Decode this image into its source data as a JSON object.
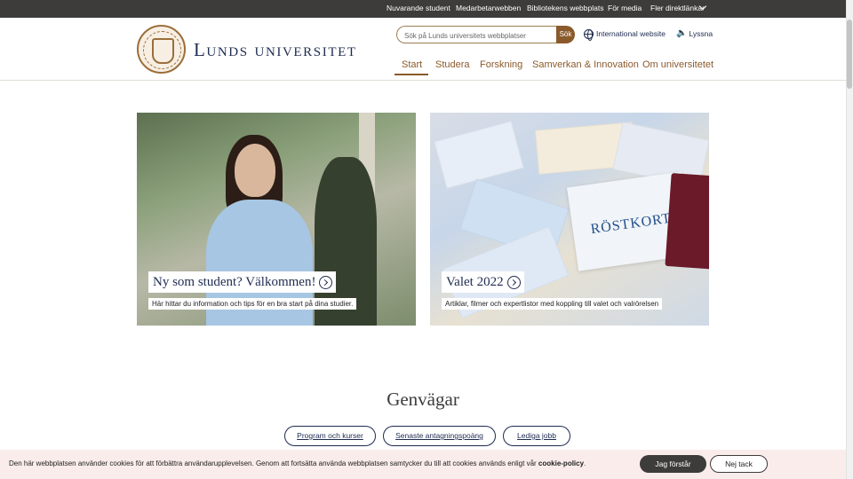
{
  "topbar": {
    "links": [
      "Nuvarande student",
      "Medarbetarwebben",
      "Bibliotekens webbplats",
      "För media",
      "Fler direktlänkar"
    ]
  },
  "header": {
    "logo_text": "Lunds universitet",
    "search_placeholder": "Sök på Lunds universitets webbplatser",
    "search_button": "Sök",
    "international_link": "International website",
    "listen_link": "Lyssna",
    "icons": [
      "globe-icon",
      "speaker-icon",
      "chevron-down-icon",
      "university-seal"
    ]
  },
  "nav": {
    "items": [
      "Start",
      "Studera",
      "Forskning",
      "Samverkan & Innovation",
      "Om universitetet"
    ],
    "active": "Start"
  },
  "cards": [
    {
      "title": "Ny som student? Välkommen!",
      "subtitle": "Här hittar du information och tips för en bra start på dina studier."
    },
    {
      "title": "Valet 2022",
      "subtitle": "Artiklar, filmer och expertlistor med koppling till valet och valrörelsen"
    }
  ],
  "card2_image_text": "RÖSTKORT",
  "shortcuts": {
    "title": "Genvägar",
    "buttons": [
      "Program och kurser",
      "Senaste antagningspoäng",
      "Lediga jobb"
    ]
  },
  "cookie": {
    "text": "Den här webbplatsen använder cookies för att förbättra användarupplevelsen. Genom att fortsätta använda webbplatsen samtycker du till att cookies används enligt vår",
    "link": "cookie-policy",
    "accept": "Jag förstår",
    "decline": "Nej tack"
  },
  "colors": {
    "topbar_bg": "#3d3c3b",
    "brand_navy": "#1e2b50",
    "brand_bronze": "#8a5a2b",
    "cookie_bg": "#f9ecea"
  }
}
